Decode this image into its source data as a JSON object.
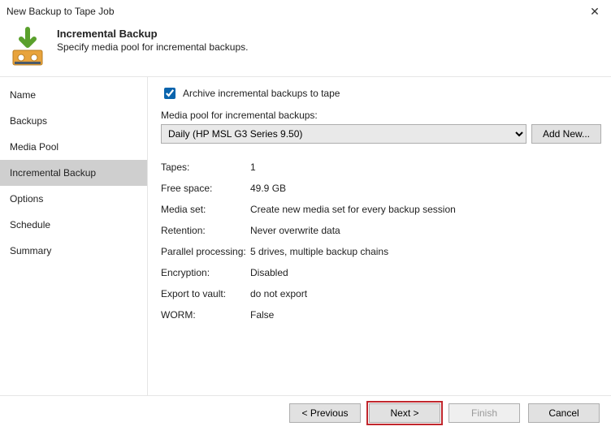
{
  "window": {
    "title": "New Backup to Tape Job",
    "close_glyph": "✕"
  },
  "header": {
    "title": "Incremental Backup",
    "subtitle": "Specify media pool for incremental backups."
  },
  "sidebar": {
    "items": [
      {
        "label": "Name"
      },
      {
        "label": "Backups"
      },
      {
        "label": "Media Pool"
      },
      {
        "label": "Incremental Backup"
      },
      {
        "label": "Options"
      },
      {
        "label": "Schedule"
      },
      {
        "label": "Summary"
      }
    ],
    "selected_index": 3
  },
  "content": {
    "archive_checkbox_label": "Archive incremental backups to tape",
    "archive_checked": true,
    "pool_label": "Media pool for incremental backups:",
    "pool_selected": "Daily (HP MSL G3 Series 9.50)",
    "add_new_label": "Add New...",
    "info": [
      {
        "k": "Tapes:",
        "v": "1"
      },
      {
        "k": "Free space:",
        "v": "49.9 GB"
      },
      {
        "k": "Media set:",
        "v": "Create new media set for every backup session"
      },
      {
        "k": "Retention:",
        "v": "Never overwrite data"
      },
      {
        "k": "Parallel processing:",
        "v": "5 drives, multiple backup chains"
      },
      {
        "k": "Encryption:",
        "v": "Disabled"
      },
      {
        "k": "Export to vault:",
        "v": "do not export"
      },
      {
        "k": "WORM:",
        "v": "False"
      }
    ]
  },
  "footer": {
    "previous": "< Previous",
    "next": "Next >",
    "finish": "Finish",
    "cancel": "Cancel"
  }
}
